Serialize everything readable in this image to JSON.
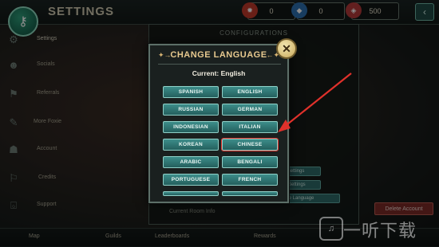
{
  "topbar": {
    "title": "SETTINGS",
    "resources": [
      {
        "icon": "flame-icon",
        "value": "0",
        "color": "#c0392b"
      },
      {
        "icon": "gem-icon",
        "value": "0",
        "color": "#2c6fb0"
      },
      {
        "icon": "ticket-icon",
        "value": "500",
        "color": "#b33a3a"
      }
    ]
  },
  "sidebar": {
    "items": [
      {
        "label": "Settings",
        "icon": "gear-icon"
      },
      {
        "label": "Socials",
        "icon": "people-icon"
      },
      {
        "label": "Referrals",
        "icon": "flag-icon"
      },
      {
        "label": "More Foxie",
        "icon": "feather-icon"
      },
      {
        "label": "Account",
        "icon": "mask-icon"
      },
      {
        "label": "Credits",
        "icon": "pennant-icon"
      },
      {
        "label": "Support",
        "icon": "basket-icon"
      }
    ]
  },
  "config": {
    "title": "CONFIGURATIONS",
    "buttons": [
      "y Settings",
      "Settings",
      "nge Language"
    ],
    "room_info": "Current Room Info",
    "delete_account": "Delete Account"
  },
  "bottomnav": {
    "items": [
      "Map",
      "Guilds",
      "Leaderboards",
      "Rewards"
    ]
  },
  "modal": {
    "title": "CHANGE LANGUAGE",
    "current": "Current: English",
    "languages": [
      [
        "SPANISH",
        "ENGLISH"
      ],
      [
        "RUSSIAN",
        "GERMAN"
      ],
      [
        "INDONESIAN",
        "ITALIAN"
      ],
      [
        "KOREAN",
        "CHINESE"
      ],
      [
        "ARABIC",
        "BENGALI"
      ],
      [
        "PORTUGUESE",
        "FRENCH"
      ]
    ],
    "highlighted": "CHINESE"
  },
  "watermark": {
    "text": "一听下载"
  },
  "colors": {
    "accent": "#2f8f8a",
    "title_gold": "#e7c98f",
    "highlight_red": "#e0312b"
  }
}
